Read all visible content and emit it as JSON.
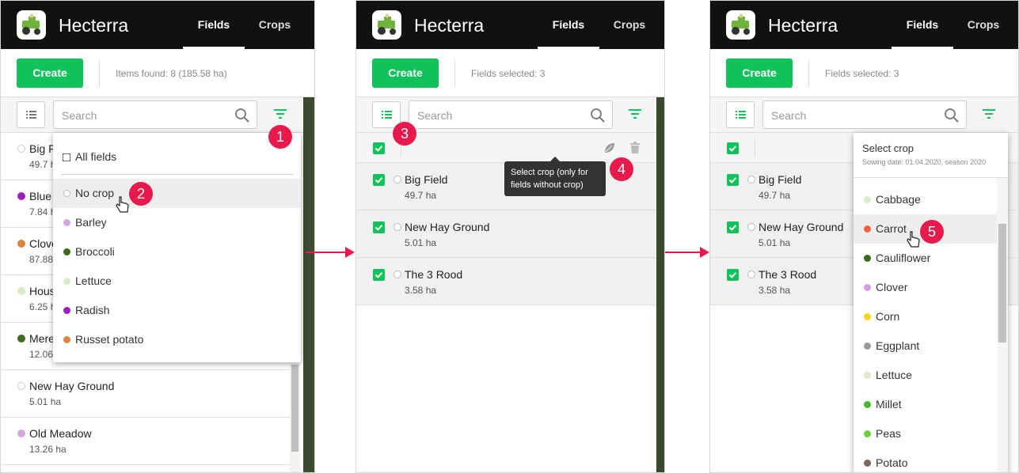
{
  "app": {
    "name": "Hecterra",
    "tabs": [
      "Fields",
      "Crops"
    ]
  },
  "panel1": {
    "create_label": "Create",
    "items_found": "Items found: 8 (185.58 ha)",
    "search_placeholder": "Search",
    "fields": [
      {
        "name": "Big F",
        "area": "49.7 h",
        "color": "#ffffff"
      },
      {
        "name": "Blue",
        "area": "7.84 h",
        "color": "#9c1fc2"
      },
      {
        "name": "Clove",
        "area": "87.88",
        "color": "#d9843a"
      },
      {
        "name": "Hous",
        "area": "6.25 h",
        "color": "#d7edc6"
      },
      {
        "name": "Mere",
        "area": "12.06",
        "color": "#3d6b1e"
      },
      {
        "name": "New Hay Ground",
        "area": "5.01 ha",
        "color": "#ffffff"
      },
      {
        "name": "Old Meadow",
        "area": "13.26 ha",
        "color": "#d7a6dd"
      }
    ],
    "dropdown": {
      "all_fields": "All fields",
      "options": [
        {
          "label": "No crop",
          "color": "#ffffff"
        },
        {
          "label": "Barley",
          "color": "#d7a6dd"
        },
        {
          "label": "Broccoli",
          "color": "#3d6b1e"
        },
        {
          "label": "Lettuce",
          "color": "#d7edc6"
        },
        {
          "label": "Radish",
          "color": "#9c1fc2"
        },
        {
          "label": "Russet potato",
          "color": "#d9843a"
        }
      ]
    }
  },
  "panel2": {
    "create_label": "Create",
    "selected": "Fields selected: 3",
    "search_placeholder": "Search",
    "tooltip": "Select crop (only for fields without crop)",
    "fields": [
      {
        "name": "Big Field",
        "area": "49.7 ha"
      },
      {
        "name": "New Hay Ground",
        "area": "5.01 ha"
      },
      {
        "name": "The 3 Rood",
        "area": "3.58 ha"
      }
    ]
  },
  "panel3": {
    "create_label": "Create",
    "selected": "Fields selected: 3",
    "search_placeholder": "Search",
    "fields": [
      {
        "name": "Big Field",
        "area": "49.7 ha"
      },
      {
        "name": "New Hay Ground",
        "area": "5.01 ha"
      },
      {
        "name": "The 3 Rood",
        "area": "3.58 ha"
      }
    ],
    "crop_dropdown": {
      "title": "Select crop",
      "subtitle": "Sowing date: 01.04.2020, season 2020",
      "options": [
        {
          "label": "Cabbage",
          "color": "#d7edc6"
        },
        {
          "label": "Carrot",
          "color": "#f0613e"
        },
        {
          "label": "Cauliflower",
          "color": "#3d6b1e"
        },
        {
          "label": "Clover",
          "color": "#d89be8"
        },
        {
          "label": "Corn",
          "color": "#f3d81f"
        },
        {
          "label": "Eggplant",
          "color": "#9a9a9a"
        },
        {
          "label": "Lettuce",
          "color": "#d7edc6"
        },
        {
          "label": "Millet",
          "color": "#48b830"
        },
        {
          "label": "Peas",
          "color": "#6fd23a"
        },
        {
          "label": "Potato",
          "color": "#7a6760"
        }
      ]
    }
  },
  "badges": [
    "1",
    "2",
    "3",
    "4",
    "5"
  ]
}
